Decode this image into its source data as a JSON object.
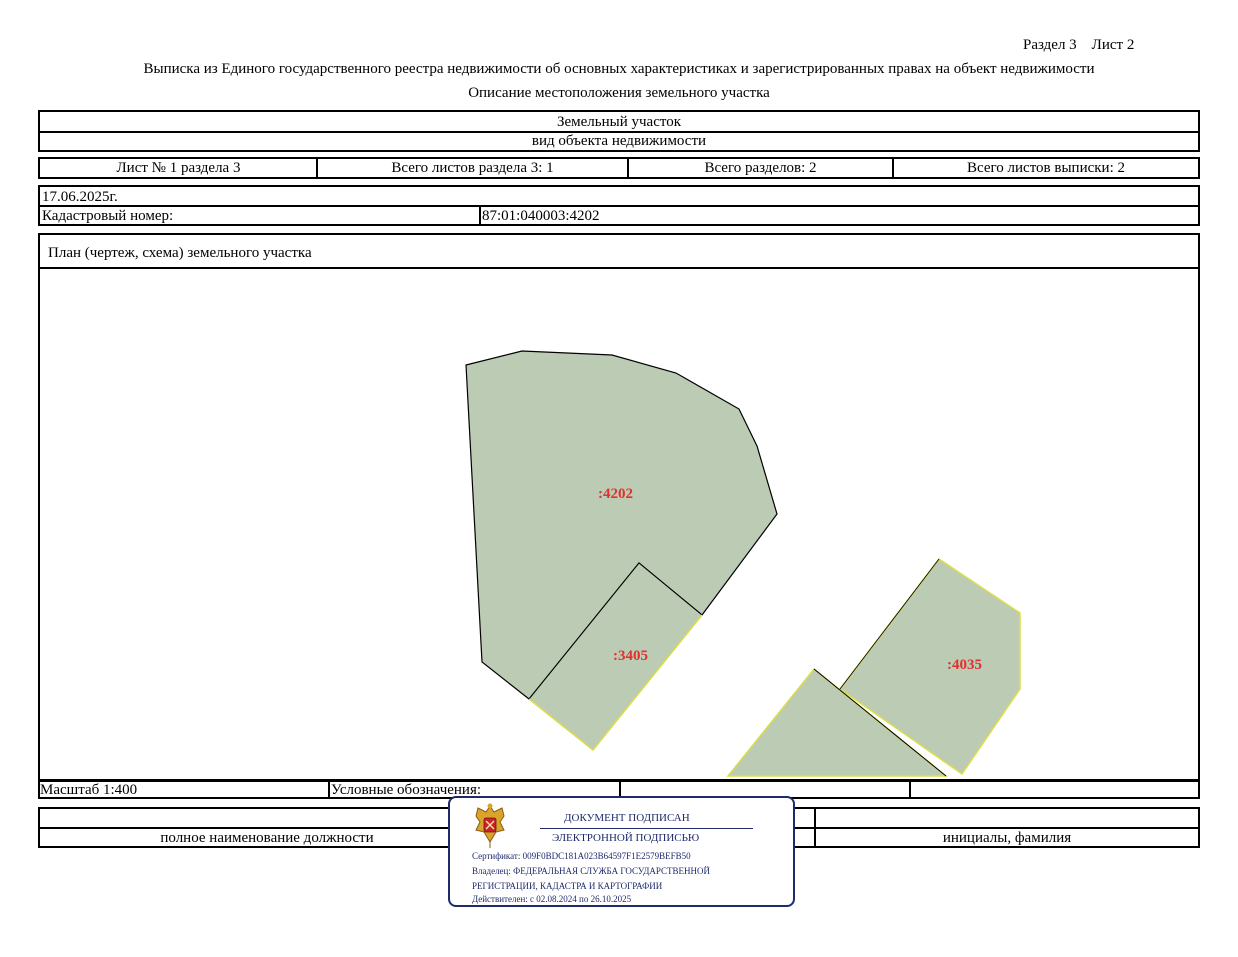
{
  "header": {
    "section_sheet": "Раздел 3    Лист 2",
    "title": "Выписка из Единого государственного реестра недвижимости об основных характеристиках и зарегистрированных правах на объект недвижимости",
    "subtitle": "Описание местоположения земельного участка"
  },
  "object": {
    "type": "Земельный участок",
    "type_caption": "вид объекта недвижимости"
  },
  "sheets": {
    "sheet_no": "Лист № 1 раздела 3",
    "total_sheets_section": "Всего листов раздела 3: 1",
    "total_sections": "Всего разделов: 2",
    "total_sheets_extract": "Всего листов выписки: 2"
  },
  "date": "17.06.2025г.",
  "cadastral": {
    "label": "Кадастровый номер:",
    "value": "87:01:040003:4202"
  },
  "plan": {
    "title": "План (чертеж, схема) земельного участка",
    "parcels": [
      {
        "label": ":4202",
        "role": "subject"
      },
      {
        "label": ":3405",
        "role": "adjacent"
      },
      {
        "label": ":4035",
        "role": "adjacent"
      }
    ],
    "fill_color": "#bccbb4",
    "label_color": "#e0312f"
  },
  "footer": {
    "scale": "Масштаб 1:400",
    "legend_label": "Условные обозначения:",
    "position_caption": "полное наименование должности",
    "name_caption": "инициалы, фамилия"
  },
  "signature_stamp": {
    "line1": "ДОКУМЕНТ ПОДПИСАН",
    "line2": "ЭЛЕКТРОННОЙ ПОДПИСЬЮ",
    "certificate": "Сертификат: 009F0BDC181A023B64597F1E2579BEFB50",
    "owner_line1": "Владелец: ФЕДЕРАЛЬНАЯ СЛУЖБА ГОСУДАРСТВЕННОЙ",
    "owner_line2": "РЕГИСТРАЦИИ, КАДАСТРА И КАРТОГРАФИИ",
    "validity": "Действителен: с 02.08.2024 по 26.10.2025",
    "border_color": "#1f2a6b"
  }
}
